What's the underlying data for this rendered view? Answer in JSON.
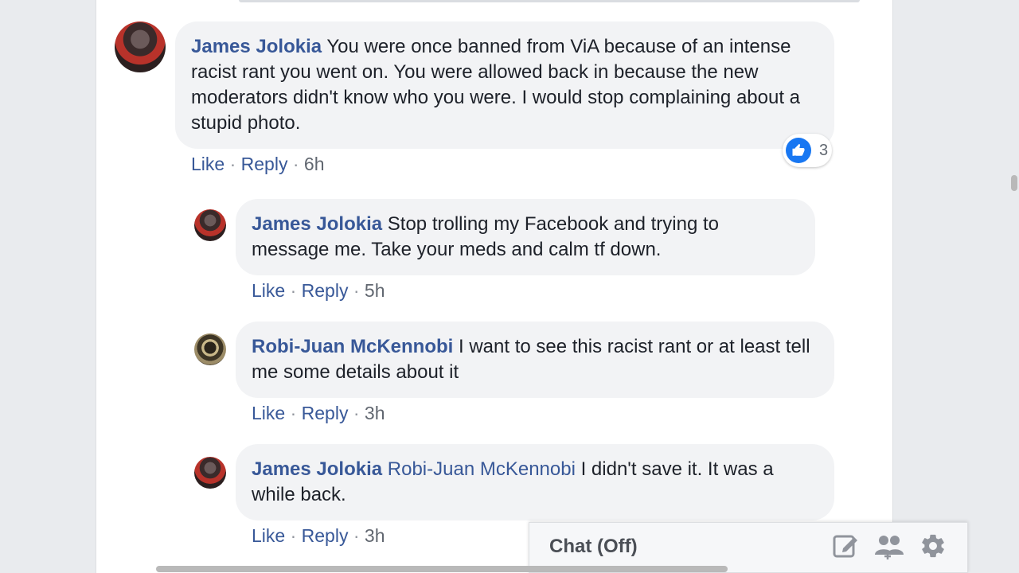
{
  "comments": [
    {
      "author": "James Jolokia",
      "mention": "",
      "text": "You were once banned from ViA because of an intense racist rant you went on. You were allowed back in because the new moderators didn't know who you were. I would stop complaining about a stupid photo.",
      "like_label": "Like",
      "reply_label": "Reply",
      "time": "6h",
      "reaction_count": "3"
    },
    {
      "author": "James Jolokia",
      "mention": "",
      "text": "Stop trolling my Facebook and trying to message me. Take your meds and calm tf down.",
      "like_label": "Like",
      "reply_label": "Reply",
      "time": "5h"
    },
    {
      "author": "Robi-Juan McKennobi",
      "mention": "",
      "text": "I want to see this racist rant or at least tell me some details about it",
      "like_label": "Like",
      "reply_label": "Reply",
      "time": "3h"
    },
    {
      "author": "James Jolokia",
      "mention": "Robi-Juan McKennobi",
      "text": "I didn't save it. It was a while back.",
      "like_label": "Like",
      "reply_label": "Reply",
      "time": "3h"
    }
  ],
  "separator": "·",
  "chat": {
    "label": "Chat (Off)"
  },
  "icons": {
    "reaction": "like-icon",
    "compose": "compose-icon",
    "groups": "create-group-icon",
    "settings": "gear-icon"
  },
  "colors": {
    "link": "#385898",
    "bubble": "#f2f3f5",
    "like_blue": "#1877f2"
  }
}
